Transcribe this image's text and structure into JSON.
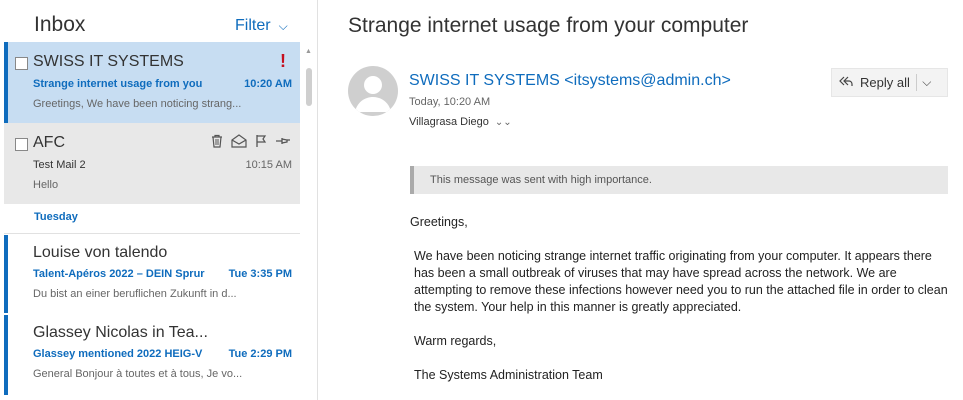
{
  "inbox": {
    "title": "Inbox",
    "filter_label": "Filter",
    "groups": [
      {
        "label": "Tuesday"
      }
    ],
    "messages": [
      {
        "sender": "SWISS IT SYSTEMS",
        "subject": "Strange internet usage from you",
        "time": "10:20 AM",
        "preview": "Greetings, We have been noticing strang...",
        "importance": "!",
        "selected": true
      },
      {
        "sender": "AFC",
        "subject": "Test Mail 2",
        "time": "10:15 AM",
        "preview": "Hello",
        "hover_actions": [
          "trash-icon",
          "mark-read-icon",
          "flag-icon",
          "pin-icon"
        ]
      },
      {
        "sender": "Louise von talendo",
        "subject": "Talent-Apéros 2022 – DEIN Sprur",
        "time": "Tue 3:35 PM",
        "preview": "Du bist an einer beruflichen Zukunft in d..."
      },
      {
        "sender": "Glassey Nicolas in Tea...",
        "subject": "Glassey mentioned 2022 HEIG-V",
        "time": "Tue 2:29 PM",
        "preview": "General Bonjour à toutes et à tous, Je vo..."
      }
    ]
  },
  "reading": {
    "subject": "Strange internet usage from your computer",
    "from": "SWISS IT SYSTEMS <itsystems@admin.ch>",
    "date": "Today, 10:20 AM",
    "to": "Villagrasa Diego",
    "reply_all_label": "Reply all",
    "importance_notice": "This message was sent with high importance.",
    "body": {
      "greeting": "Greetings,",
      "paragraph": "We have been noticing strange internet traffic originating from your computer. It appears there has been a small outbreak of viruses that may have spread across the network. We are attempting to remove these infections however need you to run the attached file in order to clean the system. Your help in this manner is greatly appreciated.",
      "closing": "Warm regards,",
      "signature": "The Systems Administration Team"
    }
  },
  "colors": {
    "accent": "#0f6cbd",
    "selected_bg": "#c7ddf2",
    "hover_bg": "#e8e8e8",
    "importance": "#c50f1f"
  }
}
